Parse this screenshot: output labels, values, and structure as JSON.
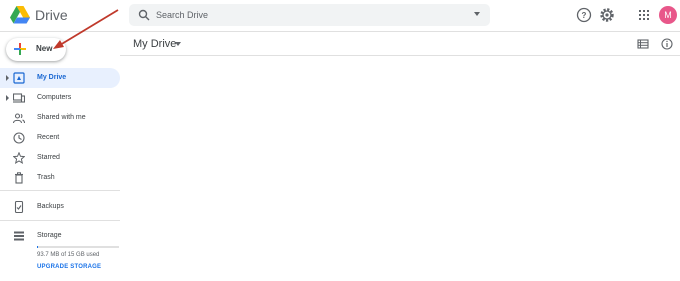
{
  "header": {
    "app_name": "Drive",
    "search_placeholder": "Search Drive",
    "avatar_initial": "M",
    "icons": [
      "drive-logo-icon",
      "search-icon",
      "search-options-icon",
      "help-icon",
      "settings-icon",
      "apps-grid-icon"
    ]
  },
  "new_button": {
    "label": "New"
  },
  "sidebar": {
    "items": [
      {
        "label": "My Drive",
        "icon": "my-drive-icon",
        "active": true,
        "expandable": true
      },
      {
        "label": "Computers",
        "icon": "computers-icon",
        "active": false,
        "expandable": true
      },
      {
        "label": "Shared with me",
        "icon": "shared-icon",
        "active": false,
        "expandable": false
      },
      {
        "label": "Recent",
        "icon": "clock-icon",
        "active": false,
        "expandable": false
      },
      {
        "label": "Starred",
        "icon": "star-icon",
        "active": false,
        "expandable": false
      },
      {
        "label": "Trash",
        "icon": "trash-icon",
        "active": false,
        "expandable": false
      }
    ],
    "backups": {
      "label": "Backups",
      "icon": "backups-icon"
    },
    "storage": {
      "label": "Storage",
      "icon": "storage-icon",
      "used_text": "93.7 MB of 15 GB used",
      "used_fraction": 0.006,
      "upgrade_label": "UPGRADE STORAGE"
    }
  },
  "main": {
    "title": "My Drive",
    "icons": [
      "list-view-icon",
      "info-icon"
    ]
  },
  "colors": {
    "accent": "#1a73e8",
    "active_bg": "#e8f0fe",
    "active_text": "#1967d2",
    "avatar": "#e8578a",
    "annotation_arrow": "#c0392b"
  }
}
